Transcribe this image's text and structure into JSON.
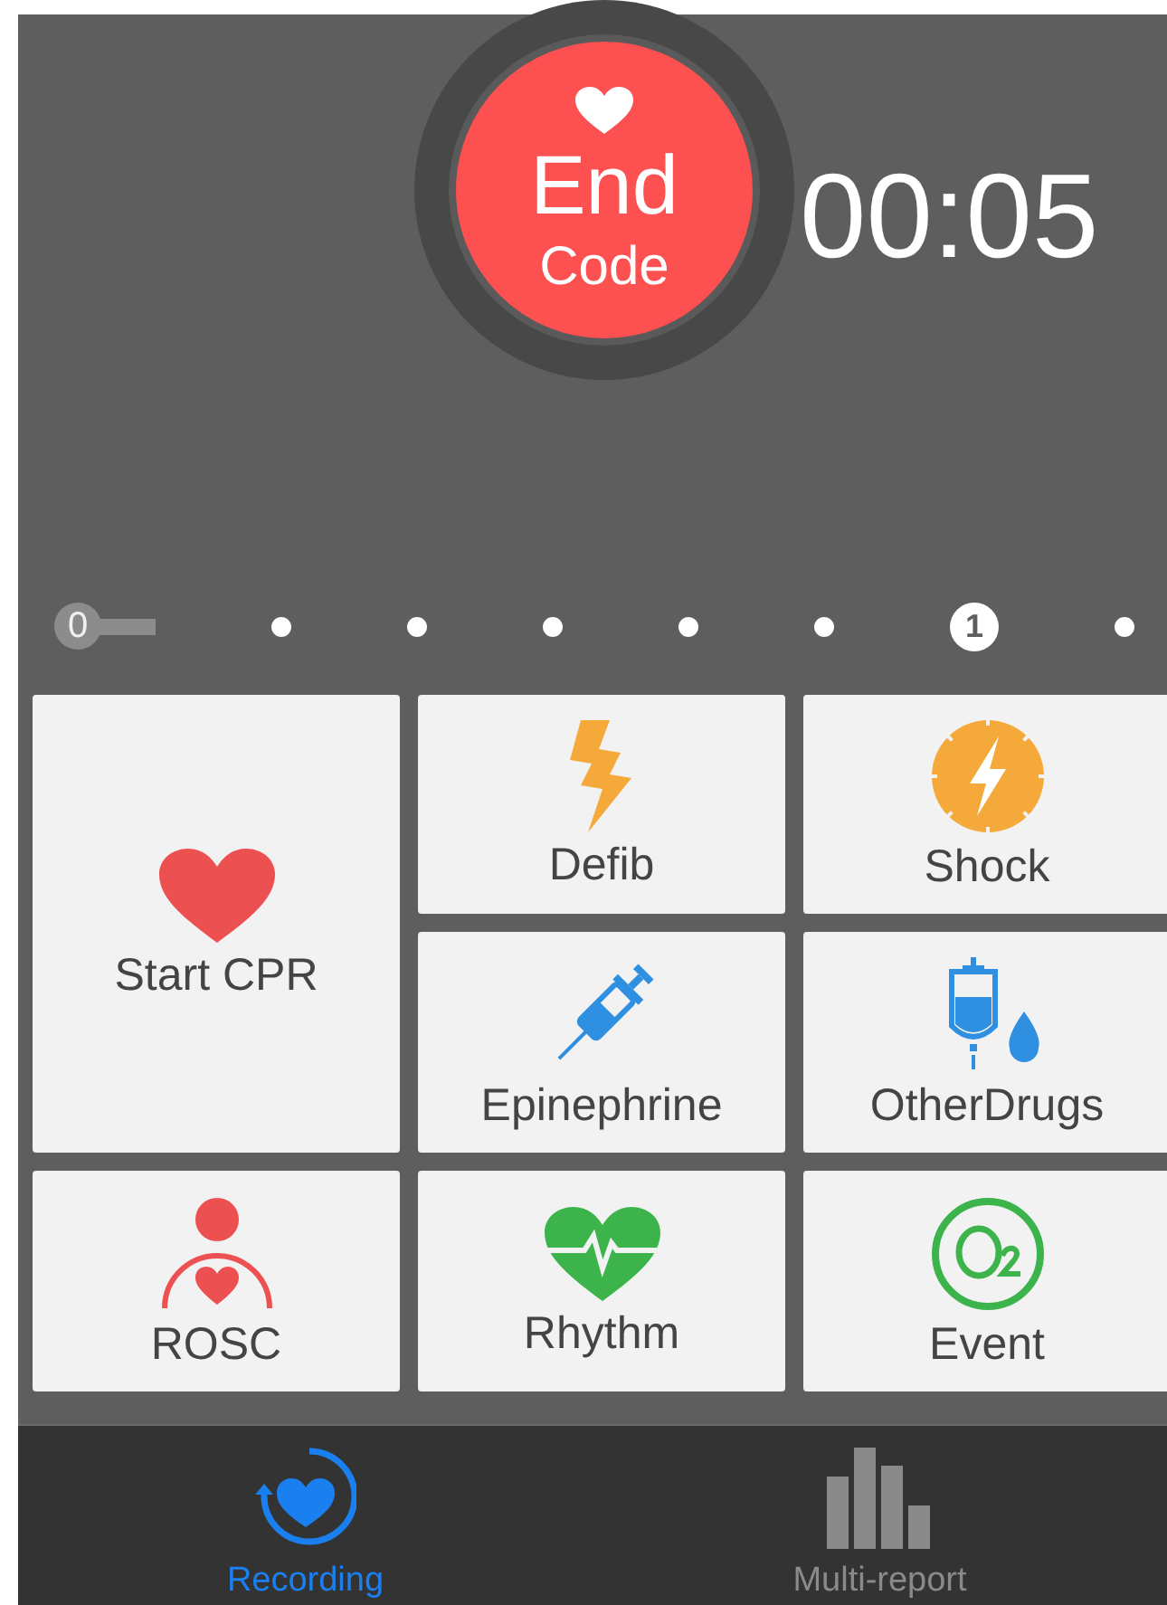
{
  "end_button": {
    "line1": "End",
    "line2": "Code"
  },
  "timer": "00:05",
  "timeline": [
    {
      "kind": "start",
      "label": "0"
    },
    {
      "kind": "dot"
    },
    {
      "kind": "dot"
    },
    {
      "kind": "dot"
    },
    {
      "kind": "dot"
    },
    {
      "kind": "dot"
    },
    {
      "kind": "minute",
      "label": "1"
    },
    {
      "kind": "dot"
    }
  ],
  "tiles": [
    {
      "label": "Start CPR",
      "kind": "heart",
      "tall": true
    },
    {
      "label": "Defib",
      "kind": "bolt",
      "tall": false
    },
    {
      "label": "Shock",
      "kind": "shock",
      "tall": false
    },
    {
      "label": "Epinephrine",
      "kind": "syringe",
      "tall": false
    },
    {
      "label": "OtherDrugs",
      "kind": "drip",
      "tall": false
    },
    {
      "label": "ROSC",
      "kind": "person",
      "tall": false
    },
    {
      "label": "Rhythm",
      "kind": "rhythm",
      "tall": false
    },
    {
      "label": "Event",
      "kind": "oxygen",
      "tall": false
    }
  ],
  "tabs": [
    {
      "label": "Recording",
      "kind": "recording",
      "selected": true
    },
    {
      "label": "Multi-report",
      "kind": "report",
      "selected": false
    }
  ]
}
